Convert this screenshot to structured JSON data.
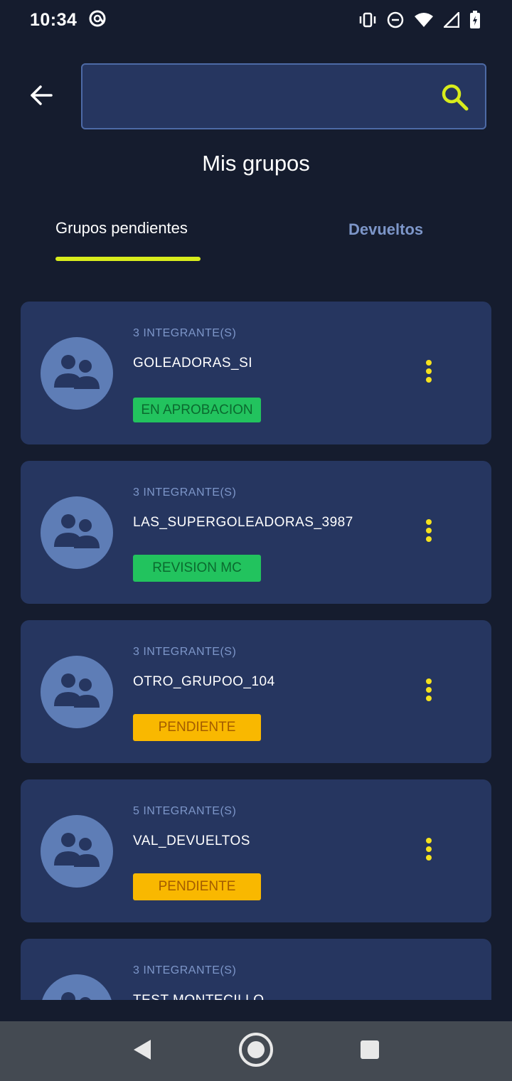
{
  "status_bar": {
    "time": "10:34",
    "icons": [
      "at-sign-icon",
      "vibrate-icon",
      "do-not-disturb-icon",
      "wifi-icon",
      "signal-icon",
      "battery-charging-icon"
    ]
  },
  "header": {
    "back_icon": "arrow-left-icon",
    "search": {
      "value": "",
      "placeholder": "",
      "icon": "search-icon"
    },
    "title": "Mis grupos"
  },
  "tabs": [
    {
      "label": "Grupos pendientes",
      "active": true
    },
    {
      "label": "Devueltos",
      "active": false
    }
  ],
  "groups": [
    {
      "members": "3 INTEGRANTE(S)",
      "name": "GOLEADORAS_SI",
      "status": "EN APROBACION",
      "status_color": "#22c35e"
    },
    {
      "members": "3 INTEGRANTE(S)",
      "name": "LAS_SUPERGOLEADORAS_3987",
      "status": "REVISION MC",
      "status_color": "#22c35e"
    },
    {
      "members": "3 INTEGRANTE(S)",
      "name": "OTRO_GRUPOO_104",
      "status": "PENDIENTE",
      "status_color": "#f9b800"
    },
    {
      "members": "5 INTEGRANTE(S)",
      "name": "VAL_DEVUELTOS",
      "status": "PENDIENTE",
      "status_color": "#f9b800"
    },
    {
      "members": "3 INTEGRANTE(S)",
      "name": "TEST MONTECILLO",
      "status": "",
      "status_color": ""
    }
  ],
  "colors": {
    "background": "#151c2e",
    "card": "#263660",
    "accent": "#d8ec1c",
    "more_dots": "#f5e21e"
  },
  "nav_bar": {
    "back": "triangle-back-icon",
    "home": "circle-home-icon",
    "recents": "square-recents-icon"
  }
}
